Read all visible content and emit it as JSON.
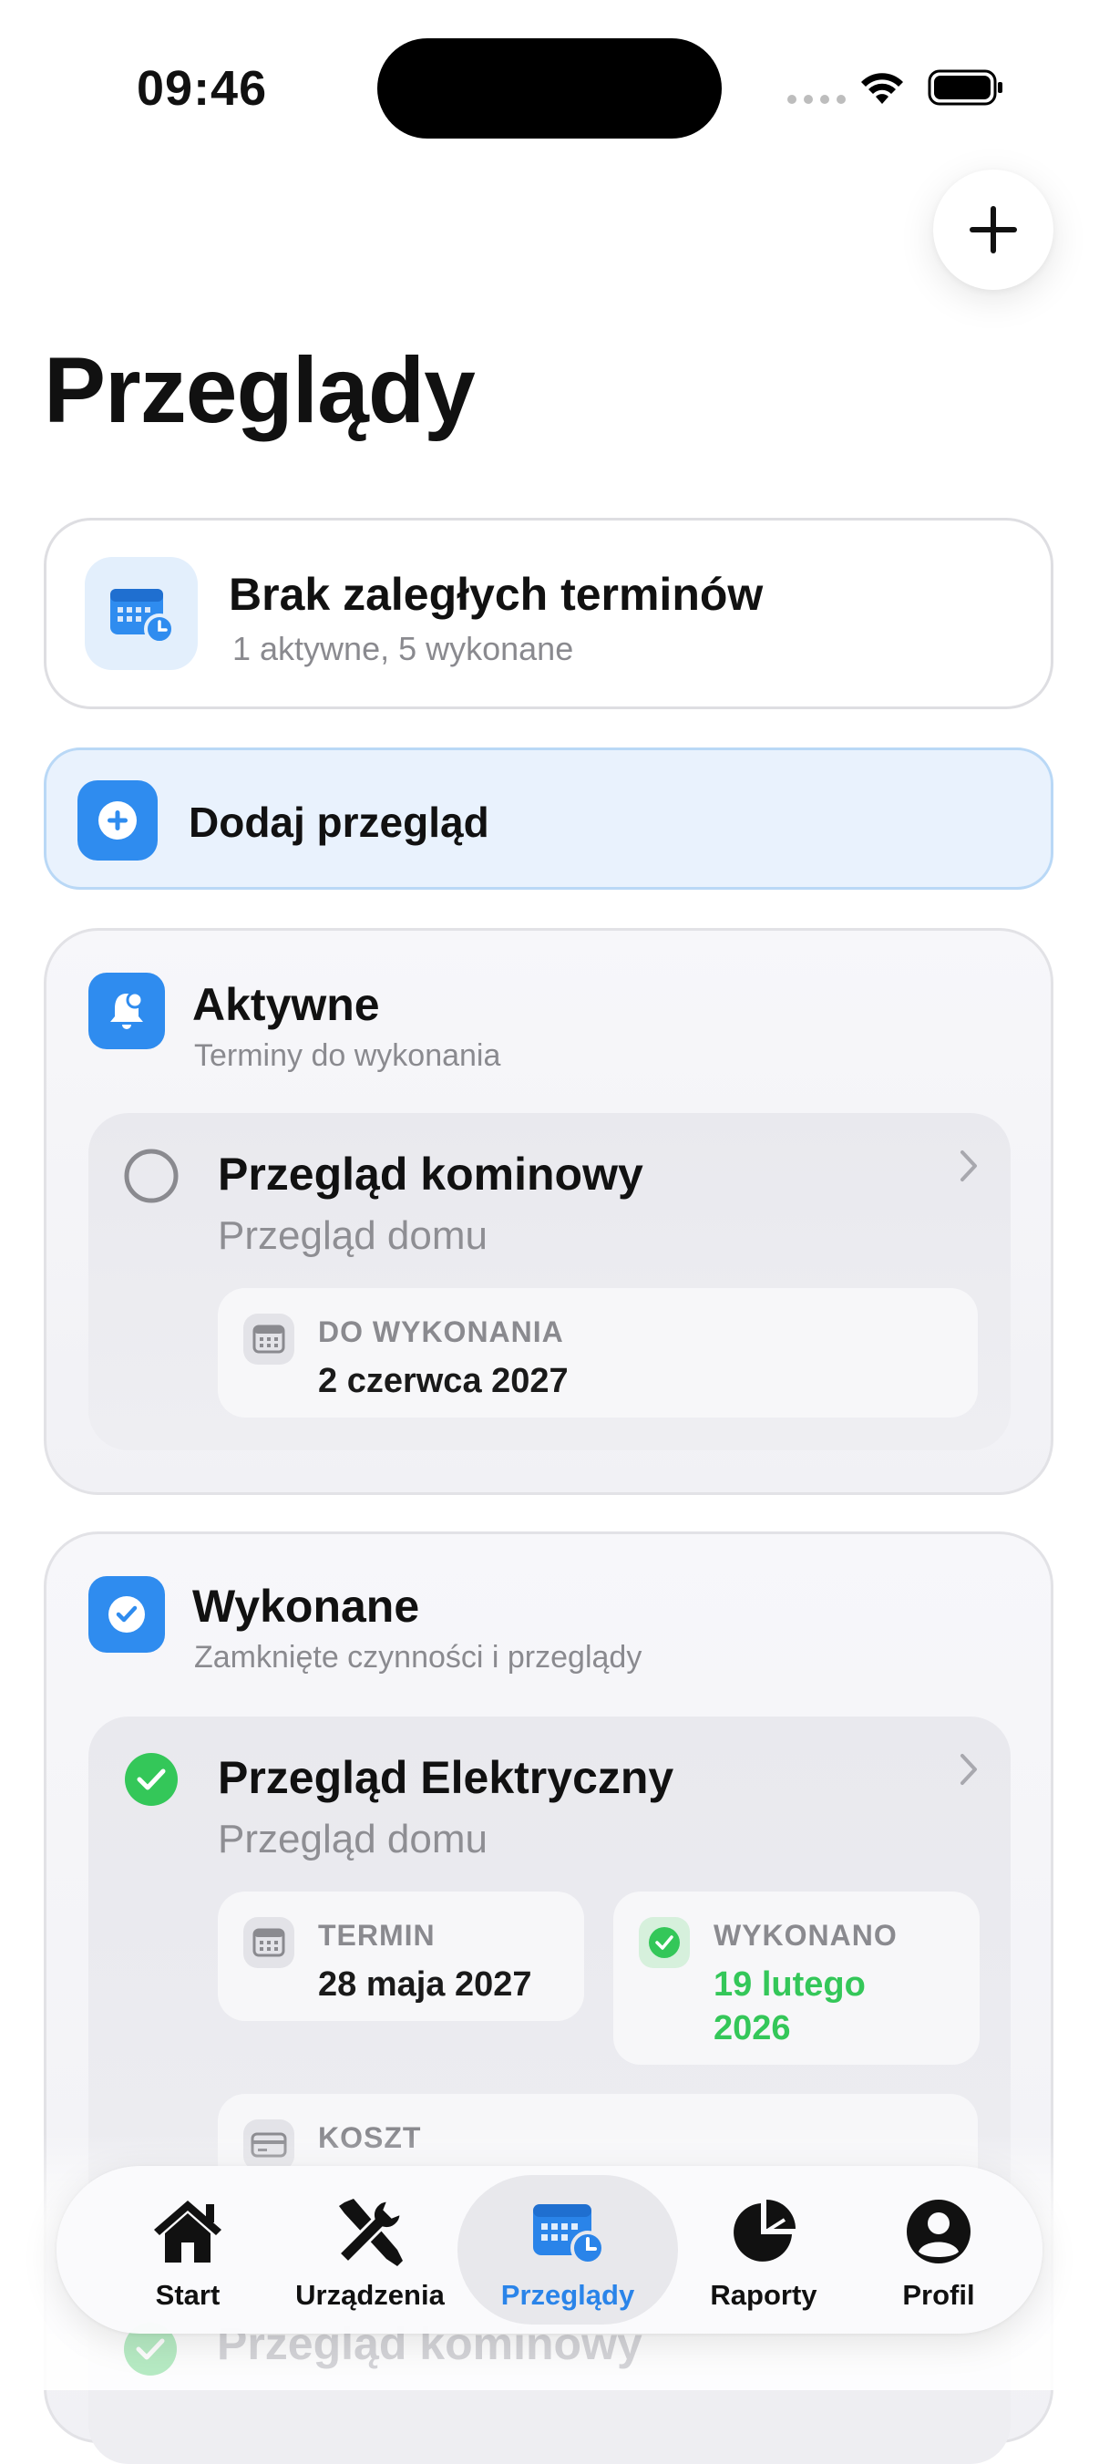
{
  "status_bar": {
    "time": "09:46"
  },
  "header": {
    "title": "Przeglądy",
    "add_icon": "plus-icon"
  },
  "summary": {
    "icon": "calendar-clock-icon",
    "title": "Brak zaległych terminów",
    "subtitle": "1 aktywne, 5 wykonane"
  },
  "add_inspection": {
    "label": "Dodaj przegląd",
    "icon": "plus-circle-icon"
  },
  "active_section": {
    "icon": "bell-icon",
    "title": "Aktywne",
    "subtitle": "Terminy do wykonania",
    "items": [
      {
        "title": "Przegląd kominowy",
        "subtitle": "Przegląd domu",
        "due_label": "DO WYKONANIA",
        "due_value": "2 czerwca 2027"
      }
    ]
  },
  "done_section": {
    "icon": "checkmark-square-icon",
    "title": "Wykonane",
    "subtitle": "Zamknięte czynności i przeglądy",
    "items": [
      {
        "title": "Przegląd Elektryczny",
        "subtitle": "Przegląd domu",
        "term_label": "TERMIN",
        "term_value": "28 maja 2027",
        "done_label": "WYKONANO",
        "done_value_line1": "19 lutego",
        "done_value_line2": "2026",
        "cost_label": "KOSZT"
      }
    ],
    "next_item_title": "Przegląd kominowy"
  },
  "colors": {
    "accent": "#2f8cef",
    "success": "#34c759",
    "tab_active": "#2a84e9"
  },
  "tab_bar": {
    "tabs": [
      {
        "label": "Start",
        "icon": "house-icon"
      },
      {
        "label": "Urządzenia",
        "icon": "tools-icon"
      },
      {
        "label": "Przeglądy",
        "icon": "calendar-clock-icon",
        "active": true
      },
      {
        "label": "Raporty",
        "icon": "pie-chart-icon"
      },
      {
        "label": "Profil",
        "icon": "person-icon"
      }
    ]
  }
}
